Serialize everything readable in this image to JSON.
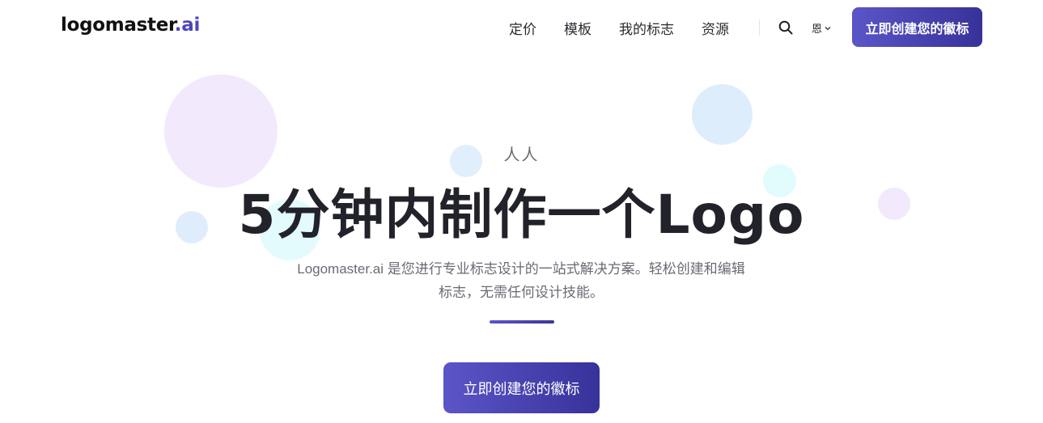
{
  "brand": {
    "name": "logomaster",
    "suffix": ".ai",
    "accent_color": "#4f46b8"
  },
  "nav": {
    "links": [
      "定价",
      "模板",
      "我的标志",
      "资源"
    ],
    "search_icon": "search-icon",
    "language": "恩",
    "cta_label": "立即创建您的徽标"
  },
  "hero": {
    "eyebrow": "人人",
    "title": "5分钟内制作一个Logo",
    "subtitle": "Logomaster.ai 是您进行专业标志设计的一站式解决方案。轻松创建和编辑标志，无需任何设计技能。",
    "cta_label": "立即创建您的徽标"
  },
  "colors": {
    "gradient_start": "#5b55c8",
    "gradient_end": "#37329a",
    "bubble_lavender": "#f1e9fc",
    "bubble_blue": "#ddeefc",
    "bubble_cyan": "#e2fbfc"
  }
}
